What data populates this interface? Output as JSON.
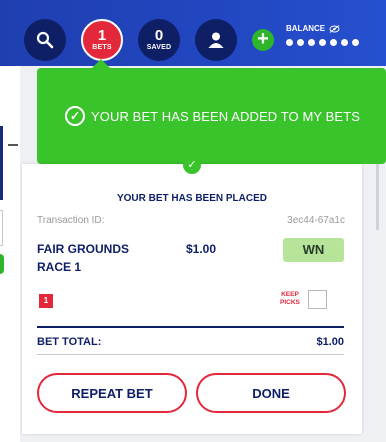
{
  "header": {
    "bets": {
      "count": "1",
      "label": "BETS"
    },
    "saved": {
      "count": "0",
      "label": "SAVED"
    },
    "balance_label": "BALANCE"
  },
  "toast": {
    "message": "YOUR BET HAS BEEN ADDED TO MY BETS"
  },
  "ticket": {
    "placed_title": "YOUR BET HAS BEEN PLACED",
    "transaction_label": "Transaction ID:",
    "transaction_id": "3ec44-67a1c",
    "race_line1": "FAIR GROUNDS",
    "race_line2": "RACE 1",
    "amount": "$1.00",
    "bet_type": "WN",
    "selection": "1",
    "keep_picks_line1": "KEEP",
    "keep_picks_line2": "PICKS",
    "total_label": "BET TOTAL:",
    "total_value": "$1.00",
    "repeat_label": "REPEAT BET",
    "done_label": "DONE"
  },
  "colors": {
    "brand_blue": "#2247c2",
    "navy": "#0e1f66",
    "accent_red": "#e4283c",
    "success_green": "#38c42a"
  }
}
